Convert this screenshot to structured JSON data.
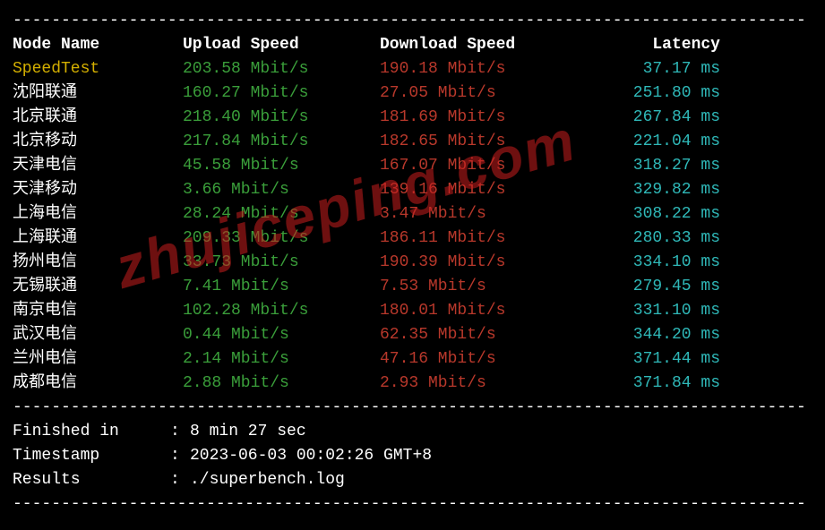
{
  "divider": "----------------------------------------------------------------------------------",
  "headers": {
    "node": "Node Name",
    "upload": "Upload Speed",
    "download": "Download Speed",
    "latency": "Latency"
  },
  "speedtest_row": {
    "name": "SpeedTest",
    "upload": "203.58 Mbit/s",
    "download": "190.18 Mbit/s",
    "latency": "37.17 ms"
  },
  "rows": [
    {
      "name": "沈阳联通",
      "upload": "160.27 Mbit/s",
      "download": "27.05 Mbit/s",
      "latency": "251.80 ms"
    },
    {
      "name": "北京联通",
      "upload": "218.40 Mbit/s",
      "download": "181.69 Mbit/s",
      "latency": "267.84 ms"
    },
    {
      "name": "北京移动",
      "upload": "217.84 Mbit/s",
      "download": "182.65 Mbit/s",
      "latency": "221.04 ms"
    },
    {
      "name": "天津电信",
      "upload": "45.58 Mbit/s",
      "download": "167.07 Mbit/s",
      "latency": "318.27 ms"
    },
    {
      "name": "天津移动",
      "upload": "3.66 Mbit/s",
      "download": "139.16 Mbit/s",
      "latency": "329.82 ms"
    },
    {
      "name": "上海电信",
      "upload": "28.24 Mbit/s",
      "download": "3.47 Mbit/s",
      "latency": "308.22 ms"
    },
    {
      "name": "上海联通",
      "upload": "209.33 Mbit/s",
      "download": "186.11 Mbit/s",
      "latency": "280.33 ms"
    },
    {
      "name": "扬州电信",
      "upload": "33.73 Mbit/s",
      "download": "190.39 Mbit/s",
      "latency": "334.10 ms"
    },
    {
      "name": "无锡联通",
      "upload": "7.41 Mbit/s",
      "download": "7.53 Mbit/s",
      "latency": "279.45 ms"
    },
    {
      "name": "南京电信",
      "upload": "102.28 Mbit/s",
      "download": "180.01 Mbit/s",
      "latency": "331.10 ms"
    },
    {
      "name": "武汉电信",
      "upload": "0.44 Mbit/s",
      "download": "62.35 Mbit/s",
      "latency": "344.20 ms"
    },
    {
      "name": "兰州电信",
      "upload": "2.14 Mbit/s",
      "download": "47.16 Mbit/s",
      "latency": "371.44 ms"
    },
    {
      "name": "成都电信",
      "upload": "2.88 Mbit/s",
      "download": "2.93 Mbit/s",
      "latency": "371.84 ms"
    }
  ],
  "footer": {
    "finished_label": "Finished in",
    "finished_value": "8 min 27 sec",
    "timestamp_label": "Timestamp",
    "timestamp_value": "2023-06-03 00:02:26 GMT+8",
    "results_label": "Results",
    "results_value": "./superbench.log",
    "sep": ":"
  },
  "watermark": "zhujiceping.com"
}
